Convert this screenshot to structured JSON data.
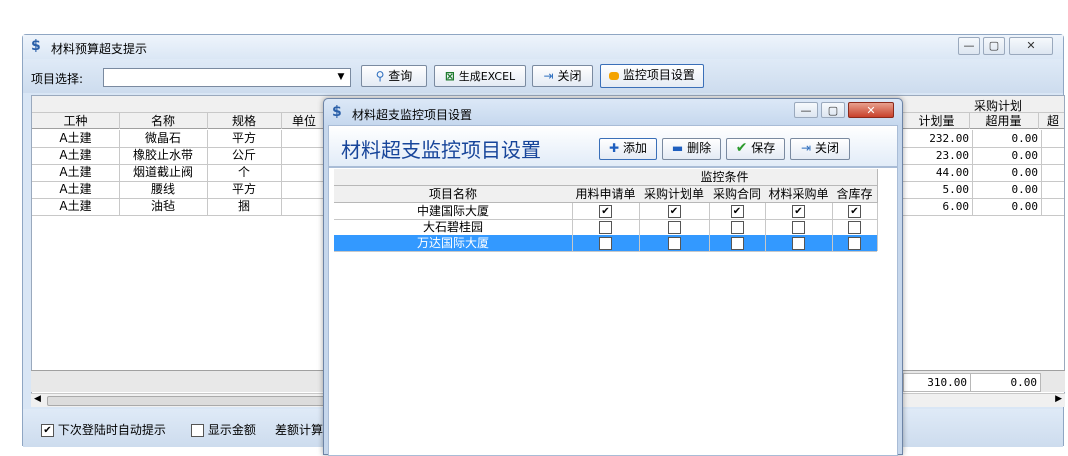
{
  "main_window": {
    "title": "材料预算超支提示",
    "toolbar": {
      "project_label": "项目选择:",
      "project_value": "",
      "query_label": "查询",
      "excel_label": "生成EXCEL",
      "close_label": "关闭",
      "monitor_label": "监控项目设置"
    },
    "grid": {
      "group_header": "采购计划",
      "headers": [
        "工种",
        "名称",
        "规格",
        "单位"
      ],
      "right_headers": [
        "计划量",
        "超用量",
        "超"
      ],
      "rows": [
        {
          "trade": "A土建",
          "name": "微晶石",
          "spec": "平方",
          "unit": "",
          "plan": "232.00",
          "over": "0.00"
        },
        {
          "trade": "A土建",
          "name": "橡胶止水带",
          "spec": "公斤",
          "unit": "",
          "plan": "23.00",
          "over": "0.00"
        },
        {
          "trade": "A土建",
          "name": "烟道截止阀",
          "spec": "个",
          "unit": "",
          "plan": "44.00",
          "over": "0.00"
        },
        {
          "trade": "A土建",
          "name": "腰线",
          "spec": "平方",
          "unit": "",
          "plan": "5.00",
          "over": "0.00"
        },
        {
          "trade": "A土建",
          "name": "油毡",
          "spec": "捆",
          "unit": "",
          "plan": "6.00",
          "over": "0.00"
        }
      ],
      "totals": {
        "plan": "310.00",
        "over": "0.00"
      }
    },
    "status": {
      "auto_prompt_label": "下次登陆时自动提示",
      "auto_prompt_checked": true,
      "show_amount_label": "显示金额",
      "show_amount_checked": false,
      "diff_label": "差额计算"
    }
  },
  "dialog": {
    "title": "材料超支监控项目设置",
    "header_title": "材料超支监控项目设置",
    "buttons": {
      "add": "添加",
      "delete": "删除",
      "save": "保存",
      "close": "关闭"
    },
    "group_header": "监控条件",
    "columns": [
      "项目名称",
      "用料申请单",
      "采购计划单",
      "采购合同",
      "材料采购单",
      "含库存"
    ],
    "rows": [
      {
        "name": "中建国际大厦",
        "checks": [
          true,
          true,
          true,
          true,
          true
        ],
        "selected": false
      },
      {
        "name": "大石碧桂园",
        "checks": [
          false,
          false,
          false,
          false,
          false
        ],
        "selected": false
      },
      {
        "name": "万达国际大厦",
        "checks": [
          false,
          false,
          false,
          false,
          false
        ],
        "selected": true
      }
    ]
  },
  "colors": {
    "selection": "#3399ff",
    "header_title": "#17459a",
    "monitor_btn": "#f4a300"
  }
}
